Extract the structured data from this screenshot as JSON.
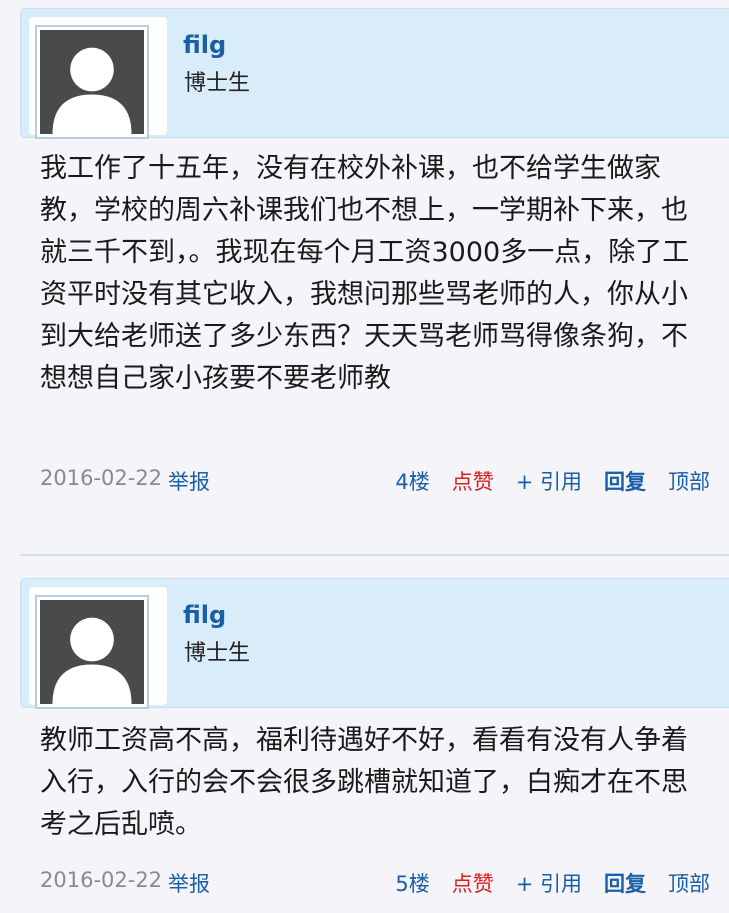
{
  "posts": [
    {
      "username": "filg",
      "role": "博士生",
      "content": "我工作了十五年，没有在校外补课，也不给学生做家教，学校的周六补课我们也不想上，一学期补下来，也就三千不到，。我现在每个月工资3000多一点，除了工资平时没有其它收入，我想问那些骂老师的人，你从小到大给老师送了多少东西？天天骂老师骂得像条狗，不想想自己家小孩要不要老师教",
      "date": "2016-02-22",
      "report": "举报",
      "floor": "4楼",
      "like": "点赞",
      "quote": "+ 引用",
      "reply": "回复",
      "top": "顶部"
    },
    {
      "username": "filg",
      "role": "博士生",
      "content": "教师工资高不高，福利待遇好不好，看看有没有人争着入行，入行的会不会很多跳槽就知道了，白痴才在不思考之后乱喷。",
      "date": "2016-02-22",
      "report": "举报",
      "floor": "5楼",
      "like": "点赞",
      "quote": "+ 引用",
      "reply": "回复",
      "top": "顶部"
    }
  ],
  "icons": {
    "avatar": "default-user-avatar-icon"
  },
  "colors": {
    "header_bg": "#d9ecfa",
    "link": "#1a5fa6",
    "like": "#d91f1f",
    "date": "#8a8a8a"
  }
}
